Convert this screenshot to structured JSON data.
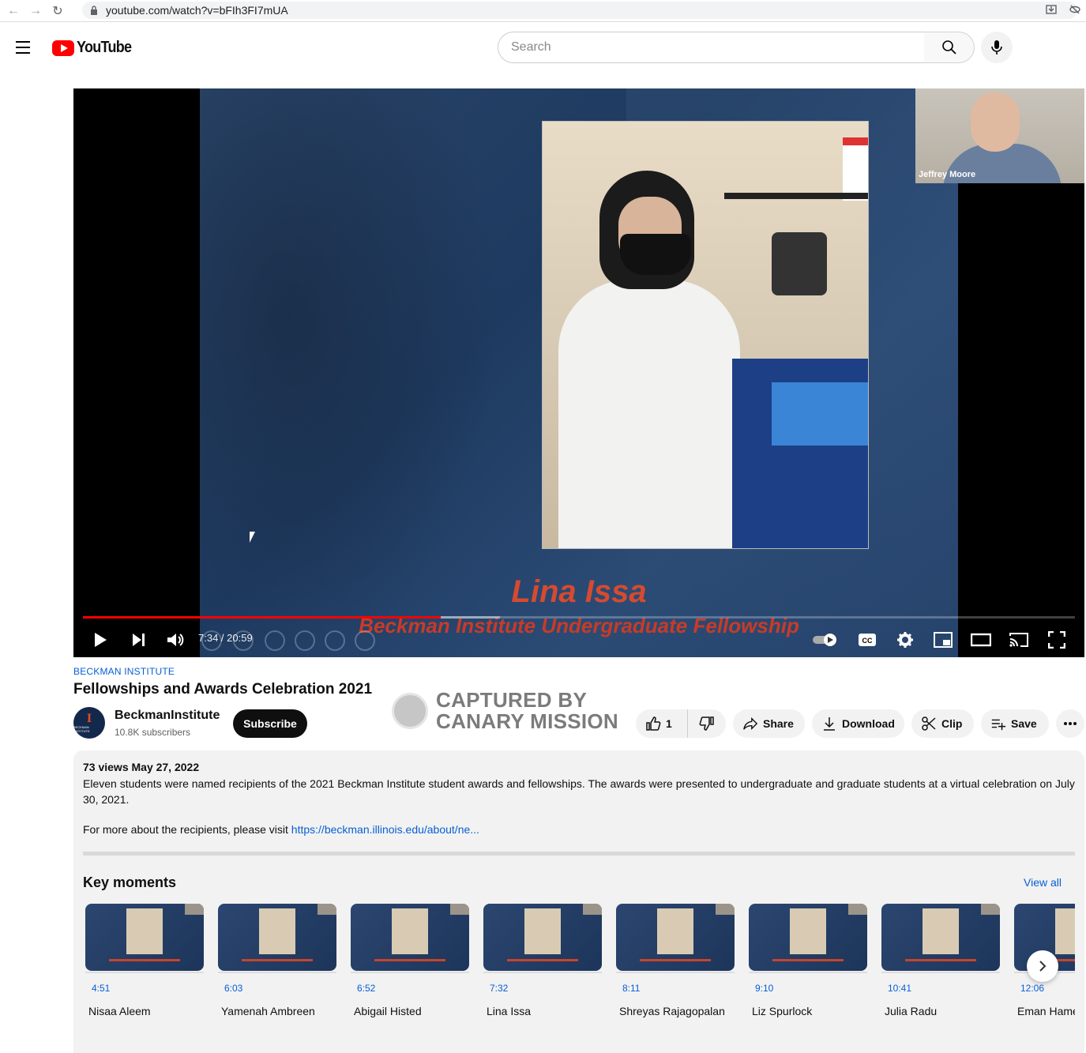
{
  "browser": {
    "url": "youtube.com/watch?v=bFIh3FI7mUA"
  },
  "masthead": {
    "logo_text": "YouTube",
    "search_placeholder": "Search"
  },
  "player": {
    "presenter_name": "Jeffrey Moore",
    "slide_name": "Lina Issa",
    "slide_subtitle": "Beckman Institute Undergraduate Fellowship",
    "time": "7:34 / 20:59",
    "progress_played": 0.361,
    "progress_loaded": 0.42
  },
  "video": {
    "channel_tag": "BECKMAN INSTITUTE",
    "title": "Fellowships and Awards Celebration 2021",
    "channel_name": "BeckmanInstitute",
    "subscribers": "10.8K subscribers",
    "subscribe_label": "Subscribe",
    "avatar_letter": "I",
    "avatar_text": "BECKMAN INSTITUTE"
  },
  "watermark": {
    "line1": "CAPTURED BY",
    "line2": "CANARY MISSION"
  },
  "actions": {
    "like_count": "1",
    "share_label": "Share",
    "download_label": "Download",
    "clip_label": "Clip",
    "save_label": "Save"
  },
  "description": {
    "meta": "73 views  May 27, 2022",
    "text": "Eleven students were named recipients of the 2021 Beckman Institute student awards and fellowships. The awards were presented to undergraduate and graduate students at a virtual celebration on July 30, 2021.",
    "more_prefix": "For more about the recipients, please visit ",
    "link": "https://beckman.illinois.edu/about/ne..."
  },
  "key_moments": {
    "title": "Key moments",
    "view_all": "View all",
    "items": [
      {
        "time": "4:51",
        "name": "Nisaa Aleem"
      },
      {
        "time": "6:03",
        "name": "Yamenah Ambreen"
      },
      {
        "time": "6:52",
        "name": "Abigail Histed"
      },
      {
        "time": "7:32",
        "name": "Lina Issa"
      },
      {
        "time": "8:11",
        "name": "Shreyas Rajagopalan"
      },
      {
        "time": "9:10",
        "name": "Liz Spurlock"
      },
      {
        "time": "10:41",
        "name": "Julia Radu"
      },
      {
        "time": "12:06",
        "name": "Eman Hame"
      }
    ]
  }
}
